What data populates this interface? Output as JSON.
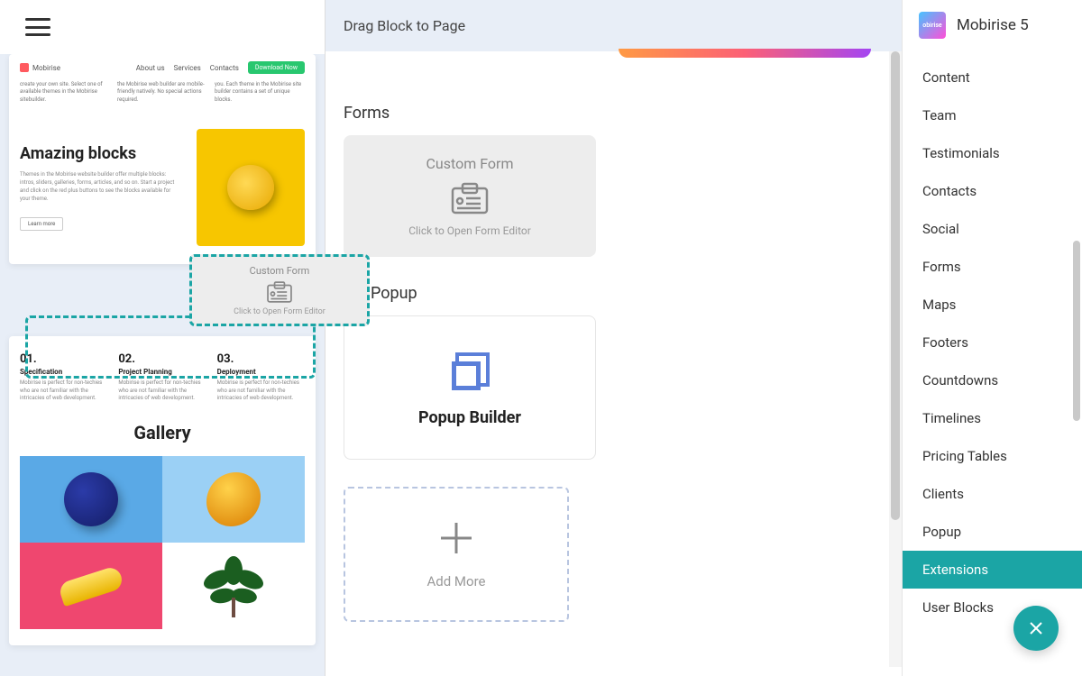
{
  "app": {
    "name": "Mobirise 5"
  },
  "header": {
    "title": "Drag Block to Page"
  },
  "previewNav": {
    "brand": "Mobirise",
    "links": [
      "About us",
      "Services",
      "Contacts"
    ],
    "cta": "Download Now"
  },
  "previewCols": [
    "create your own site. Select one of available themes in the Mobirise sitebuilder.",
    "the Mobirise web builder are mobile-friendly natively. No special actions required.",
    "you. Each theme in the Mobirise site builder contains a set of unique blocks."
  ],
  "hero": {
    "title": "Amazing blocks",
    "desc": "Themes in the Mobirise website builder offer multiple blocks: intros, sliders, galleries, forms, articles, and so on. Start a project and click on the red plus buttons to see the blocks available for your theme.",
    "learn": "Learn more"
  },
  "steps": [
    {
      "num": "01.",
      "title": "Specification",
      "desc": "Mobirise is perfect for non-techies who are not familiar with the intricacies of web development."
    },
    {
      "num": "02.",
      "title": "Project Planning",
      "desc": "Mobirise is perfect for non-techies who are not familiar with the intricacies of web development."
    },
    {
      "num": "03.",
      "title": "Deployment",
      "desc": "Mobirise is perfect for non-techies who are not familiar with the intricacies of web development."
    }
  ],
  "gallery": {
    "title": "Gallery"
  },
  "sections": {
    "forms": "Forms",
    "popup": "Popup"
  },
  "customForm": {
    "title": "Custom Form",
    "sub": "Click to Open Form Editor"
  },
  "popupBuilder": {
    "title": "Popup Builder"
  },
  "addMore": {
    "label": "Add More"
  },
  "categories": [
    "Content",
    "Team",
    "Testimonials",
    "Contacts",
    "Social",
    "Forms",
    "Maps",
    "Footers",
    "Countdowns",
    "Timelines",
    "Pricing Tables",
    "Clients",
    "Popup",
    "Extensions",
    "User Blocks"
  ],
  "activeCategory": "Extensions"
}
